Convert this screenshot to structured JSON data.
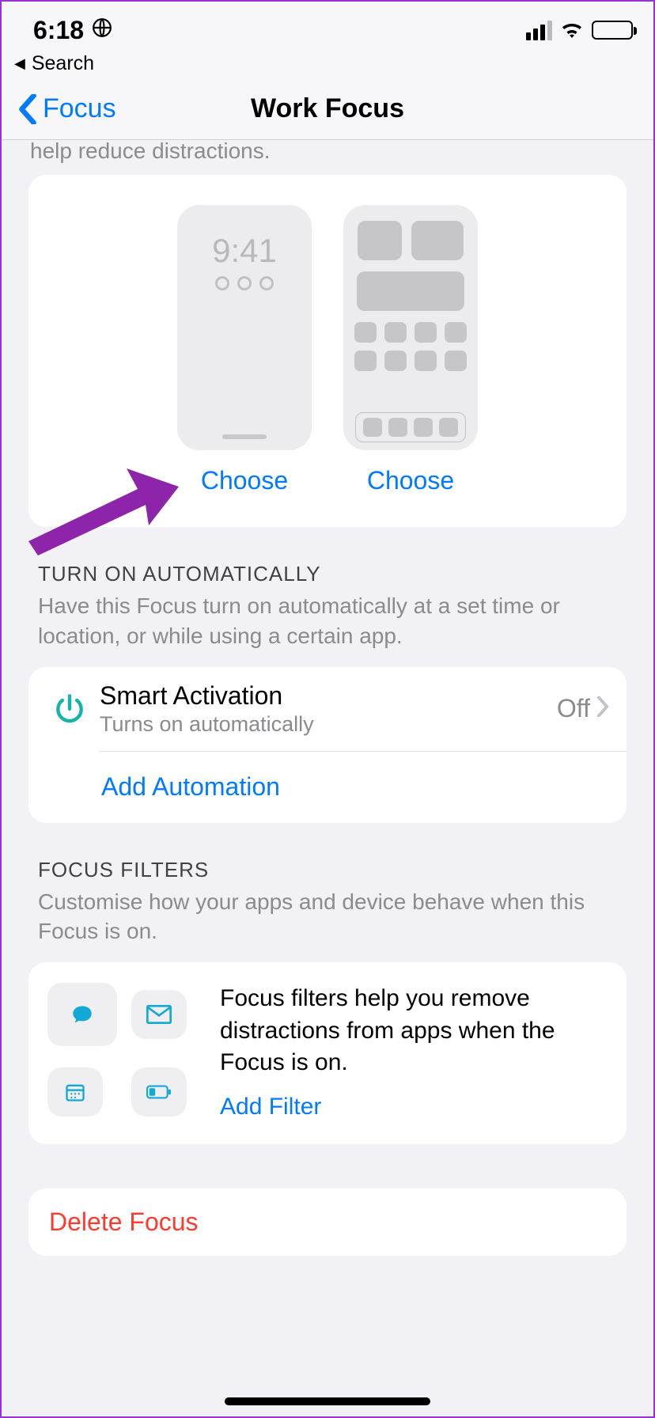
{
  "status": {
    "time": "6:18"
  },
  "breadcrumb": {
    "label": "Search"
  },
  "nav": {
    "back": "Focus",
    "title": "Work Focus"
  },
  "truncated_desc": "help reduce distractions.",
  "screens": {
    "lock_time": "9:41",
    "choose_lock": "Choose",
    "choose_home": "Choose"
  },
  "auto": {
    "header": "TURN ON AUTOMATICALLY",
    "desc": "Have this Focus turn on automatically at a set time or location, or while using a certain app.",
    "smart_title": "Smart Activation",
    "smart_sub": "Turns on automatically",
    "smart_value": "Off",
    "add": "Add Automation"
  },
  "filters": {
    "header": "FOCUS FILTERS",
    "desc": "Customise how your apps and device behave when this Focus is on.",
    "body": "Focus filters help you remove distractions from apps when the Focus is on.",
    "add": "Add Filter"
  },
  "delete": {
    "label": "Delete Focus"
  }
}
